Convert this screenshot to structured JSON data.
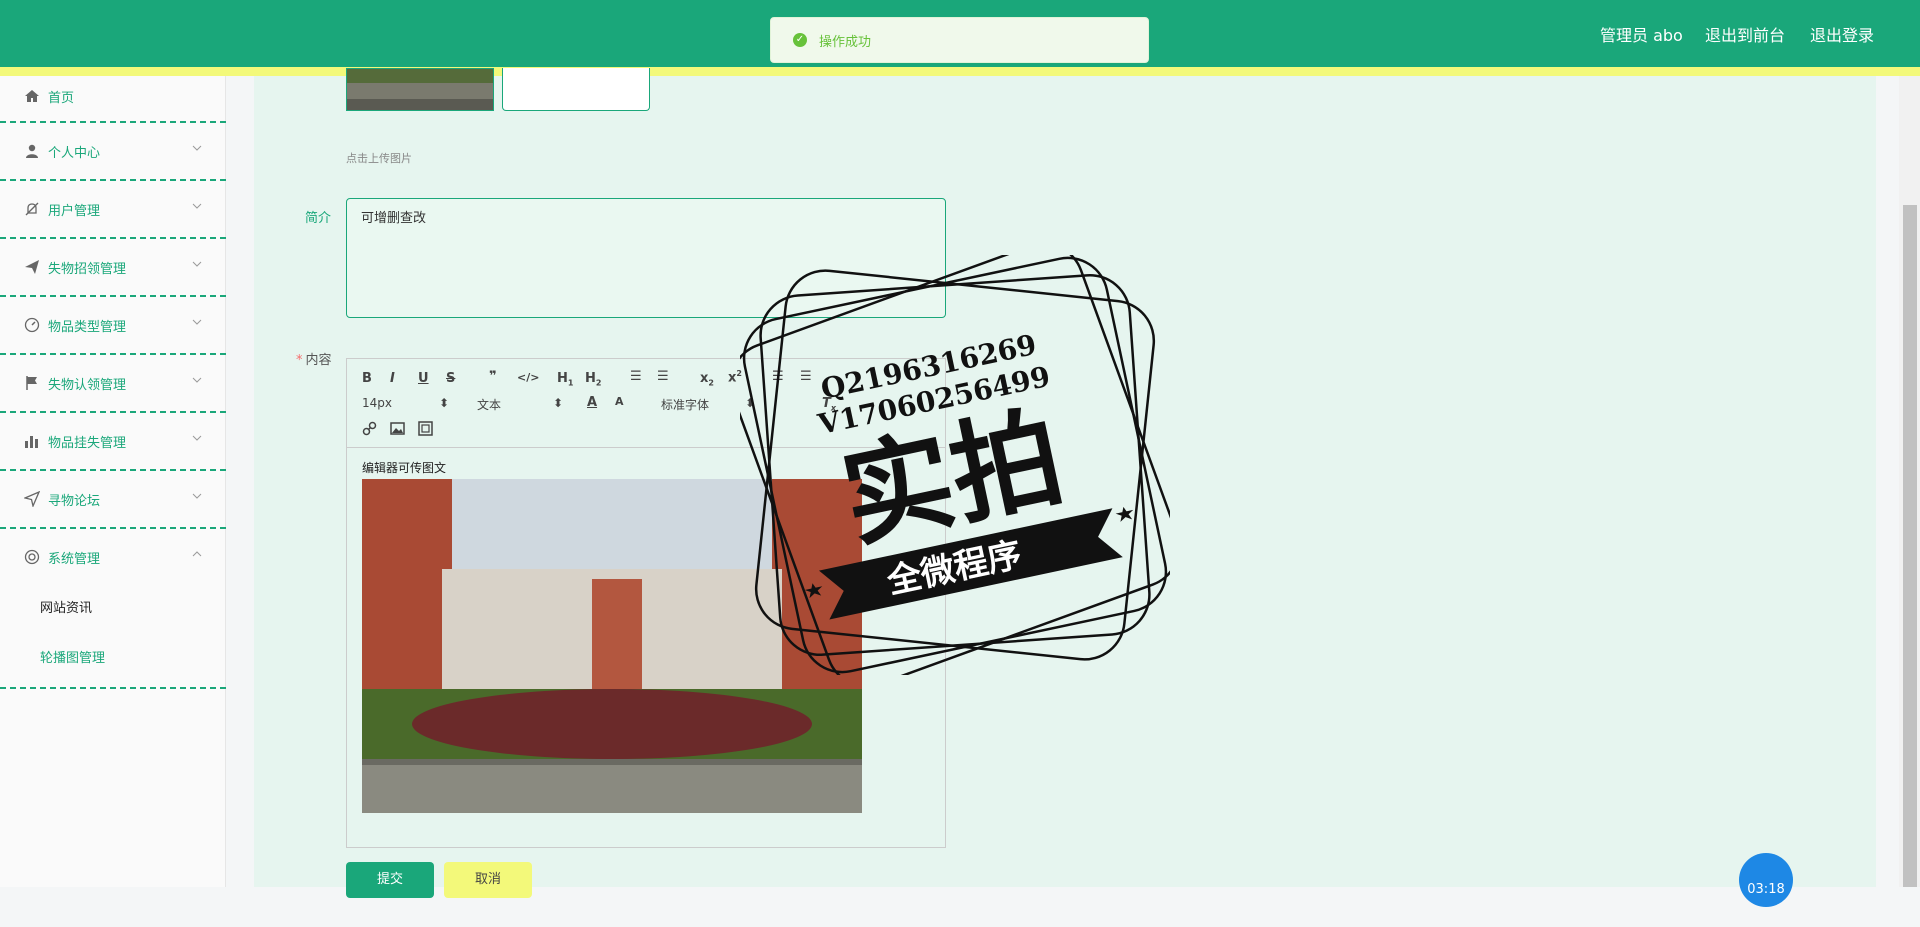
{
  "header": {
    "admin_label": "管理员 abo",
    "front_link": "退出到前台",
    "logout_link": "退出登录"
  },
  "toast": {
    "message": "操作成功"
  },
  "sidebar": {
    "items": [
      {
        "label": "首页",
        "icon": "home-icon"
      },
      {
        "label": "个人中心",
        "icon": "user-icon"
      },
      {
        "label": "用户管理",
        "icon": "bell-off-icon"
      },
      {
        "label": "失物招领管理",
        "icon": "send-icon"
      },
      {
        "label": "物品类型管理",
        "icon": "gauge-icon"
      },
      {
        "label": "失物认领管理",
        "icon": "flag-icon"
      },
      {
        "label": "物品挂失管理",
        "icon": "bar-chart-icon"
      },
      {
        "label": "寻物论坛",
        "icon": "navigation-icon"
      },
      {
        "label": "系统管理",
        "icon": "settings-circle-icon"
      }
    ],
    "sub_items": [
      "网站资讯",
      "轮播图管理"
    ]
  },
  "form": {
    "upload_hint": "点击上传图片",
    "intro_label": "简介",
    "intro_value": "可增删查改",
    "content_label": "内容",
    "editor": {
      "font_size": "14px",
      "block_type": "文本",
      "font_family": "标准字体",
      "body_text": "编辑器可传图文"
    },
    "submit_label": "提交",
    "cancel_label": "取消"
  },
  "watermark": {
    "qq": "Q2196316269",
    "wechat": "V17060256499",
    "main_text": "实拍",
    "banner_text": "全微程序"
  },
  "timer": {
    "text": "03:18"
  },
  "colors": {
    "primary": "#1aa77a",
    "accent": "#f3f97a",
    "success": "#67c23a"
  }
}
